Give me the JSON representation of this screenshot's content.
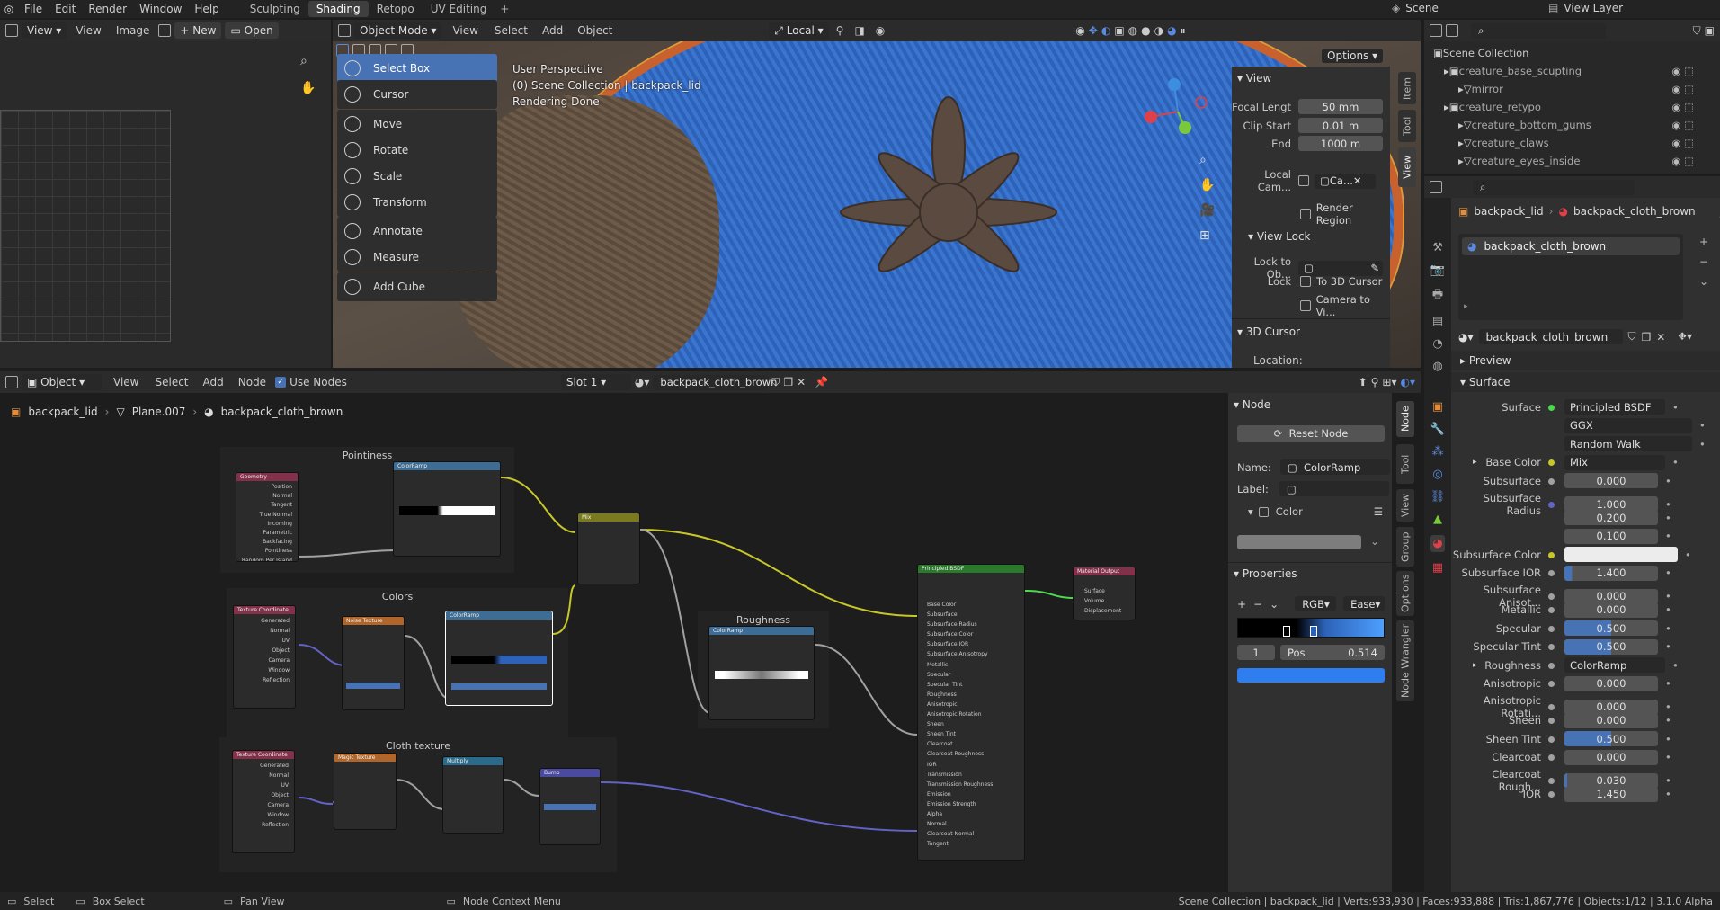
{
  "topbar": {
    "menus": [
      "File",
      "Edit",
      "Render",
      "Window",
      "Help"
    ],
    "workspaces": [
      "Sculpting",
      "Shading",
      "Retopo",
      "UV Editing"
    ],
    "active_workspace": "Shading",
    "scene": "Scene",
    "view_layer": "View Layer"
  },
  "image_editor": {
    "view": "View",
    "view_menu": "View",
    "image_menu": "Image",
    "new": "New",
    "open": "Open"
  },
  "viewport": {
    "mode": "Object Mode",
    "menus": [
      "View",
      "Select",
      "Add",
      "Object"
    ],
    "orientation": "Local",
    "options": "Options",
    "overlay_lines": [
      "User Perspective",
      "(0) Scene Collection | backpack_lid",
      "Rendering Done"
    ],
    "tools": [
      {
        "label": "Select Box",
        "active": true
      },
      {
        "label": "Cursor",
        "active": false
      },
      {
        "label": "Move",
        "active": false
      },
      {
        "label": "Rotate",
        "active": false
      },
      {
        "label": "Scale",
        "active": false
      },
      {
        "label": "Transform",
        "active": false
      },
      {
        "label": "Annotate",
        "active": false
      },
      {
        "label": "Measure",
        "active": false
      },
      {
        "label": "Add Cube",
        "active": false
      }
    ],
    "sidebar_tabs": [
      "Item",
      "Tool",
      "View"
    ],
    "view_panel": {
      "title": "View",
      "focal_length_label": "Focal Lengt",
      "focal_length": "50 mm",
      "clip_start_label": "Clip Start",
      "clip_start": "0.01 m",
      "end_label": "End",
      "end": "1000 m",
      "local_camera_label": "Local Cam...",
      "local_camera_value": "Ca...",
      "render_region": "Render Region",
      "view_lock_title": "View Lock",
      "lock_to_object_label": "Lock to Ob...",
      "lock_label": "Lock",
      "to_3d_cursor": "To 3D Cursor",
      "camera_to_view": "Camera to Vi...",
      "cursor_title": "3D Cursor",
      "location_label": "Location:"
    }
  },
  "outliner": {
    "scene_collection": "Scene Collection",
    "items": [
      "creature_base_scupting",
      "mirror",
      "creature_retypo",
      "creature_bottom_gums",
      "creature_claws",
      "creature_eyes_inside"
    ]
  },
  "properties": {
    "breadcrumb_object": "backpack_lid",
    "breadcrumb_material": "backpack_cloth_brown",
    "material_slot": "backpack_cloth_brown",
    "material_name": "backpack_cloth_brown",
    "preview": "Preview",
    "surface_section": "Surface",
    "rows": [
      {
        "label": "Surface",
        "value": "Principled BSDF",
        "type": "link",
        "dot": "green"
      },
      {
        "label": "",
        "value": "GGX",
        "type": "select"
      },
      {
        "label": "",
        "value": "Random Walk",
        "type": "select"
      },
      {
        "label": "Base Color",
        "value": "Mix",
        "type": "link",
        "dot": "yellow",
        "expand": true
      },
      {
        "label": "Subsurface",
        "value": "0.000",
        "type": "num",
        "dot": "gray",
        "fill": 0
      },
      {
        "label": "Subsurface Radius",
        "value": "1.000",
        "type": "num",
        "dot": "purple",
        "fill": 0
      },
      {
        "label": "",
        "value": "0.200",
        "type": "num",
        "fill": 0
      },
      {
        "label": "",
        "value": "0.100",
        "type": "num",
        "fill": 0
      },
      {
        "label": "Subsurface Color",
        "value": "",
        "type": "color",
        "dot": "yellow"
      },
      {
        "label": "Subsurface IOR",
        "value": "1.400",
        "type": "num",
        "dot": "gray",
        "fill": 0.08
      },
      {
        "label": "Subsurface Anisot...",
        "value": "0.000",
        "type": "num",
        "dot": "gray",
        "fill": 0
      },
      {
        "label": "Metallic",
        "value": "0.000",
        "type": "num",
        "dot": "gray",
        "fill": 0
      },
      {
        "label": "Specular",
        "value": "0.500",
        "type": "num",
        "dot": "gray",
        "fill": 0.5
      },
      {
        "label": "Specular Tint",
        "value": "0.500",
        "type": "num",
        "dot": "gray",
        "fill": 0.5
      },
      {
        "label": "Roughness",
        "value": "ColorRamp",
        "type": "link",
        "dot": "gray",
        "expand": true
      },
      {
        "label": "Anisotropic",
        "value": "0.000",
        "type": "num",
        "dot": "gray",
        "fill": 0
      },
      {
        "label": "Anisotropic Rotati...",
        "value": "0.000",
        "type": "num",
        "dot": "gray",
        "fill": 0
      },
      {
        "label": "Sheen",
        "value": "0.000",
        "type": "num",
        "dot": "gray",
        "fill": 0
      },
      {
        "label": "Sheen Tint",
        "value": "0.500",
        "type": "num",
        "dot": "gray",
        "fill": 0.5
      },
      {
        "label": "Clearcoat",
        "value": "0.000",
        "type": "num",
        "dot": "gray",
        "fill": 0
      },
      {
        "label": "Clearcoat Rough...",
        "value": "0.030",
        "type": "num",
        "dot": "gray",
        "fill": 0.03
      },
      {
        "label": "IOR",
        "value": "1.450",
        "type": "num",
        "dot": "gray",
        "fill": 0
      }
    ]
  },
  "node_editor": {
    "type": "Object",
    "menus": [
      "View",
      "Select",
      "Add",
      "Node"
    ],
    "use_nodes": "Use Nodes",
    "slot": "Slot 1",
    "material": "backpack_cloth_brown",
    "breadcrumb": [
      "backpack_lid",
      "Plane.007",
      "backpack_cloth_brown"
    ],
    "frames": [
      "Pointiness",
      "Colors",
      "Roughness",
      "Cloth texture"
    ],
    "nodes": {
      "geometry": "Geometry",
      "colorramp": "ColorRamp",
      "mix": "Mix",
      "tex_coord": "Texture Coordinate",
      "noise": "Noise Texture",
      "magic": "Magic Texture",
      "multiply": "Multiply",
      "bump": "Bump",
      "bsdf": "Principled BSDF",
      "output": "Material Output"
    },
    "geometry_outputs": [
      "Position",
      "Normal",
      "Tangent",
      "True Normal",
      "Incoming",
      "Parametric",
      "Backfacing",
      "Pointiness",
      "Random Per Island"
    ],
    "texcoord_outputs": [
      "Generated",
      "Normal",
      "UV",
      "Object",
      "Camera",
      "Window",
      "Reflection"
    ],
    "bsdf_inputs": [
      "Base Color",
      "Subsurface",
      "Subsurface Radius",
      "Subsurface Color",
      "Subsurface IOR",
      "Subsurface Anisotropy",
      "Metallic",
      "Specular",
      "Specular Tint",
      "Roughness",
      "Anisotropic",
      "Anisotropic Rotation",
      "Sheen",
      "Sheen Tint",
      "Clearcoat",
      "Clearcoat Roughness",
      "IOR",
      "Transmission",
      "Transmission Roughness",
      "Emission",
      "Emission Strength",
      "Alpha",
      "Normal",
      "Clearcoat Normal",
      "Tangent"
    ],
    "output_inputs": [
      "Surface",
      "Volume",
      "Displacement"
    ],
    "sidebar": {
      "tabs": [
        "Node",
        "Tool",
        "View",
        "Group",
        "Options",
        "Node Wrangler"
      ],
      "node_title": "Node",
      "reset_node": "Reset Node",
      "name_label": "Name:",
      "name_value": "ColorRamp",
      "label_label": "Label:",
      "color_section": "Color",
      "properties_title": "Properties",
      "color_mode": "RGB",
      "interpolation": "Ease",
      "stop_index": "1",
      "pos_label": "Pos",
      "pos_value": "0.514"
    }
  },
  "statusbar": {
    "select": "Select",
    "box_select": "Box Select",
    "pan_view": "Pan View",
    "context_menu": "Node Context Menu",
    "stats": "Scene Collection | backpack_lid | Verts:933,930 | Faces:933,888 | Tris:1,867,776 | Objects:1/12 | 3.1.0 Alpha"
  }
}
